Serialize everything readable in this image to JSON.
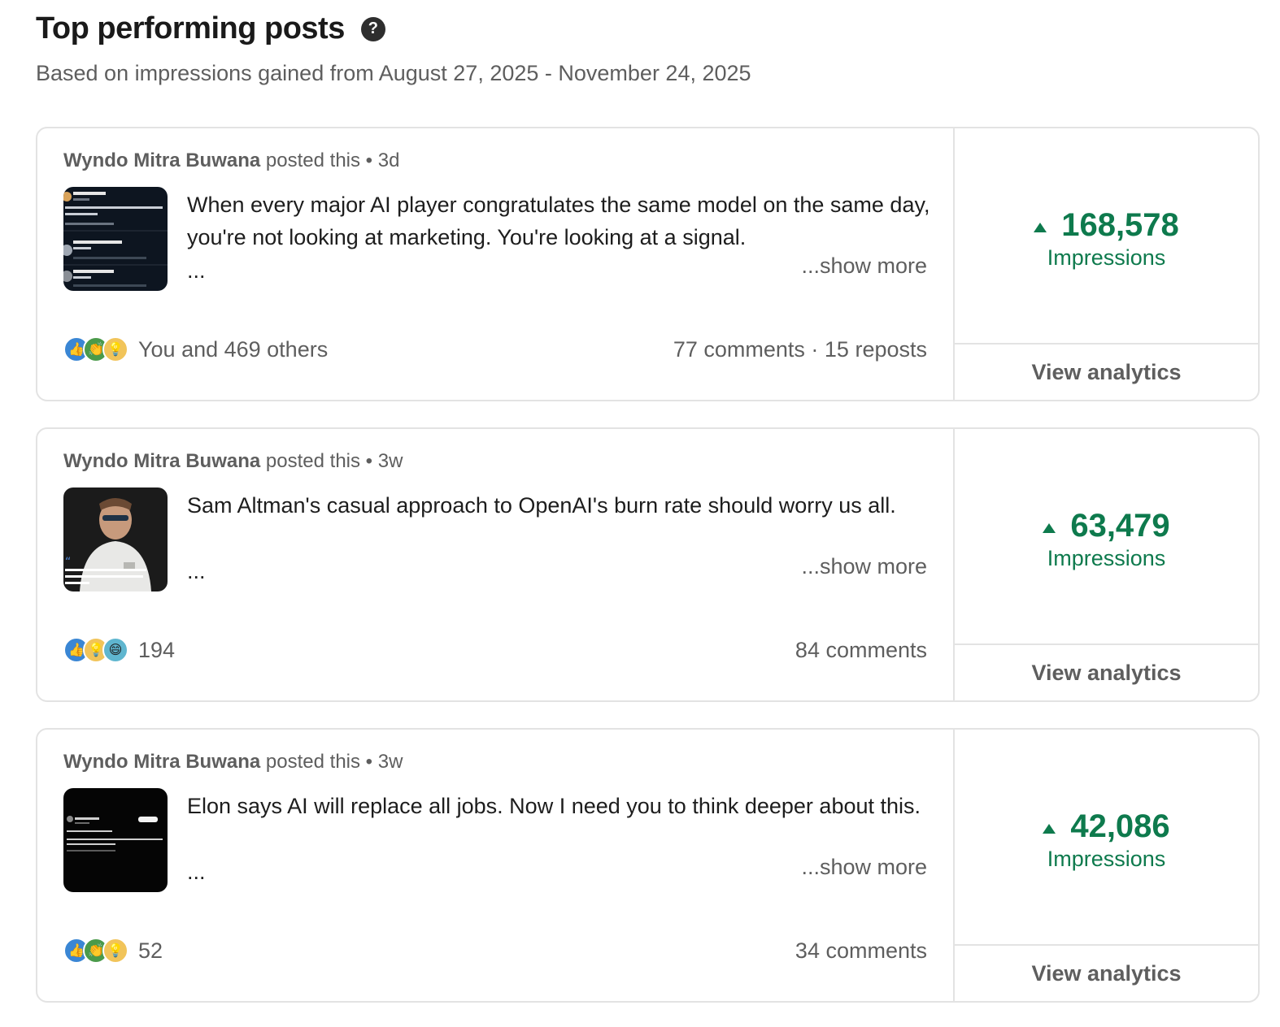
{
  "header": {
    "title": "Top performing posts",
    "help_icon": "?",
    "subtitle": "Based on impressions gained from August 27, 2025 - November 24, 2025"
  },
  "labels": {
    "posted_this": "posted this",
    "separator": "•",
    "show_more": "...show more",
    "ellipsis": "...",
    "impressions": "Impressions",
    "view_analytics": "View analytics"
  },
  "colors": {
    "accent_green": "#0e7a4d",
    "muted_text": "#5e5e5e",
    "border": "#e3e3e3"
  },
  "posts": [
    {
      "author": "Wyndo Mitra Buwana",
      "age": "3d",
      "text": "When every major AI player congratulates the same model on the same day, you're not looking at marketing. You're looking at a signal.",
      "reactions": [
        "like-icon",
        "celebrate-icon",
        "insightful-icon"
      ],
      "reaction_text": "You and 469 others",
      "engagement": "77 comments · 15 reposts",
      "impressions": "168,578"
    },
    {
      "author": "Wyndo Mitra Buwana",
      "age": "3w",
      "text": "Sam Altman's casual approach to OpenAI's burn rate should worry us all.",
      "reactions": [
        "like-icon",
        "insightful-icon",
        "funny-icon"
      ],
      "reaction_text": "194",
      "engagement": "84 comments",
      "impressions": "63,479"
    },
    {
      "author": "Wyndo Mitra Buwana",
      "age": "3w",
      "text": "Elon says AI will replace all jobs. Now I need you to think deeper about this.",
      "reactions": [
        "like-icon",
        "celebrate-icon",
        "insightful-icon"
      ],
      "reaction_text": "52",
      "engagement": "34 comments",
      "impressions": "42,086"
    }
  ]
}
